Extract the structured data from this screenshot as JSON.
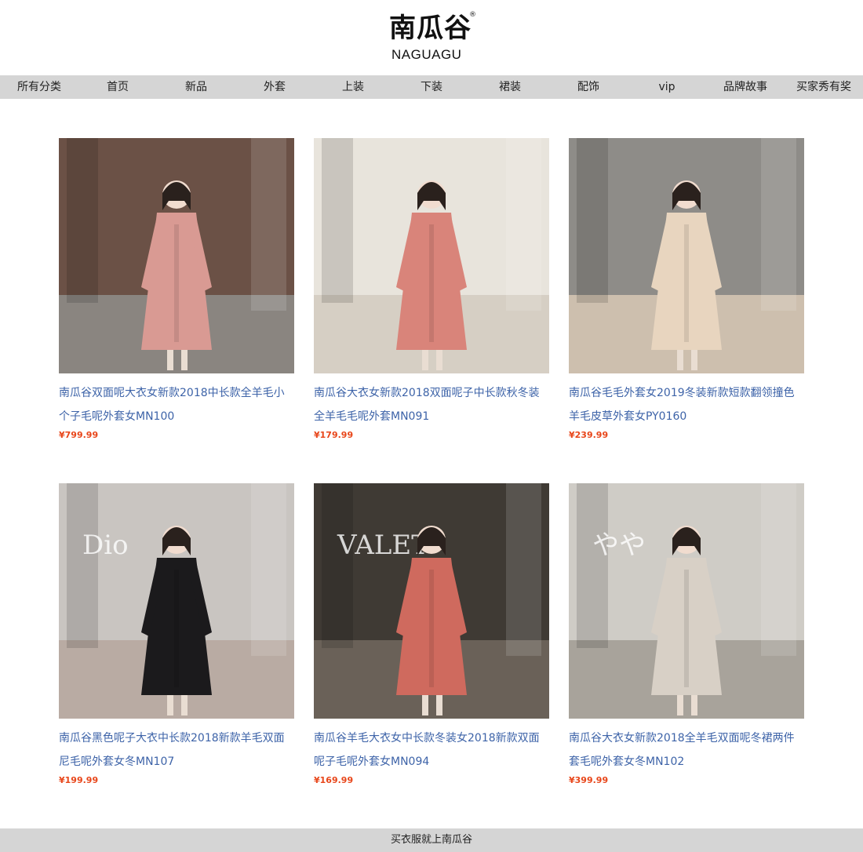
{
  "brand": {
    "name_cn": "南瓜谷",
    "name_en": "NAGUAGU",
    "reg_mark": "®"
  },
  "nav": {
    "items": [
      {
        "label": "所有分类"
      },
      {
        "label": "首页"
      },
      {
        "label": "新品"
      },
      {
        "label": "外套"
      },
      {
        "label": "上装"
      },
      {
        "label": "下装"
      },
      {
        "label": "裙装"
      },
      {
        "label": "配饰"
      },
      {
        "label": "vip"
      },
      {
        "label": "品牌故事"
      },
      {
        "label": "买家秀有奖"
      }
    ]
  },
  "products": [
    {
      "title": "南瓜谷双面呢大衣女新款2018中长款全羊毛小个子毛呢外套女MN100",
      "price": "¥799.99",
      "coat_color": "#d99a93",
      "bg_color": "#6b5146",
      "ground_color": "#8a8580"
    },
    {
      "title": "南瓜谷大衣女新款2018双面呢子中长款秋冬装全羊毛毛呢外套MN091",
      "price": "¥179.99",
      "coat_color": "#d9847a",
      "bg_color": "#e8e4dc",
      "ground_color": "#d6cfc4"
    },
    {
      "title": "南瓜谷毛毛外套女2019冬装新款短款翻领撞色羊毛皮草外套女PY0160",
      "price": "¥239.99",
      "coat_color": "#e8d5bf",
      "bg_color": "#8e8c88",
      "ground_color": "#cdbfae"
    },
    {
      "title": "南瓜谷黑色呢子大衣中长款2018新款羊毛双面尼毛呢外套女冬MN107",
      "price": "¥199.99",
      "coat_color": "#1b1a1c",
      "bg_color": "#c9c5c1",
      "ground_color": "#b9aba3",
      "sign_text": "Dio"
    },
    {
      "title": "南瓜谷羊毛大衣女中长款冬装女2018新款双面呢子毛呢外套女MN094",
      "price": "¥169.99",
      "coat_color": "#cf6a5e",
      "bg_color": "#3f3a34",
      "ground_color": "#6a6158",
      "sign_text": "VALET"
    },
    {
      "title": "南瓜谷大衣女新款2018全羊毛双面呢冬裙两件套毛呢外套女冬MN102",
      "price": "¥399.99",
      "coat_color": "#d8d0c6",
      "bg_color": "#cfccc6",
      "ground_color": "#a8a39b",
      "sign_text": "やや"
    }
  ],
  "footer": {
    "text": "买衣服就上南瓜谷"
  }
}
